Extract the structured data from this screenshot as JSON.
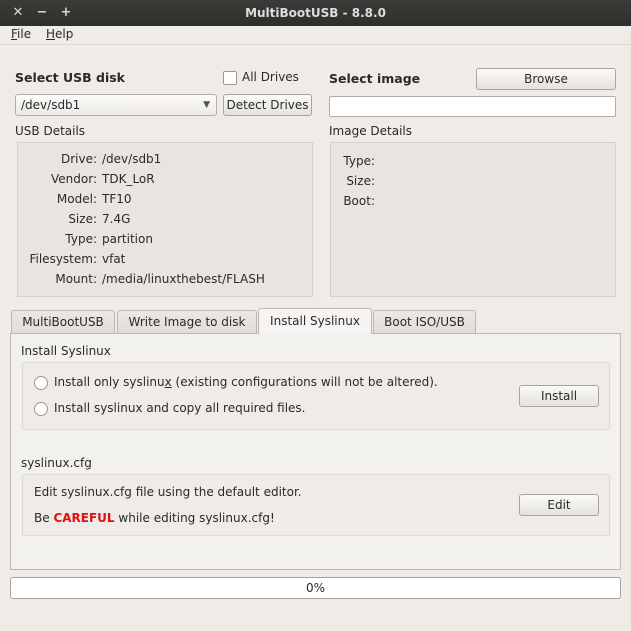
{
  "window": {
    "title": "MultiBootUSB - 8.8.0",
    "controls": [
      "close-icon",
      "minimize-icon",
      "maximize-icon"
    ]
  },
  "menu": {
    "file": "File",
    "help": "Help"
  },
  "usb": {
    "heading": "Select USB disk",
    "all_drives_label": "All Drives",
    "all_drives_checked": false,
    "selected_drive": "/dev/sdb1",
    "detect_button": "Detect Drives",
    "details_label": "USB Details",
    "details": [
      {
        "key": "Drive:",
        "value": "/dev/sdb1"
      },
      {
        "key": "Vendor:",
        "value": "TDK_LoR"
      },
      {
        "key": "Model:",
        "value": "TF10"
      },
      {
        "key": "Size:",
        "value": "7.4G"
      },
      {
        "key": "Type:",
        "value": "partition"
      },
      {
        "key": "Filesystem:",
        "value": "vfat"
      },
      {
        "key": "Mount:",
        "value": "/media/linuxthebest/FLASH"
      }
    ]
  },
  "image": {
    "heading": "Select image",
    "browse_button": "Browse",
    "path_value": "",
    "details_label": "Image Details",
    "details": [
      {
        "key": "Type:",
        "value": ""
      },
      {
        "key": "Size:",
        "value": ""
      },
      {
        "key": "Boot:",
        "value": ""
      }
    ]
  },
  "tabs": [
    {
      "label": "MultiBootUSB",
      "active": false
    },
    {
      "label": "Write Image to disk",
      "active": false
    },
    {
      "label": "Install Syslinux",
      "active": true
    },
    {
      "label": "Boot ISO/USB",
      "active": false
    }
  ],
  "syslinux": {
    "section_title": "Install Syslinux",
    "option1": "Install only syslinux (existing configurations will not be altered).",
    "option2": "Install syslinux and copy all required files.",
    "install_button": "Install",
    "cfg_title": "syslinux.cfg",
    "cfg_desc": "Edit syslinux.cfg file using the default editor.",
    "warn_prefix": "Be",
    "warn_emph": "CAREFUL",
    "warn_suffix": "while editing syslinux.cfg!",
    "warn_color": "#e01010",
    "edit_button": "Edit"
  },
  "progress": {
    "value": 0,
    "text": "0%"
  }
}
